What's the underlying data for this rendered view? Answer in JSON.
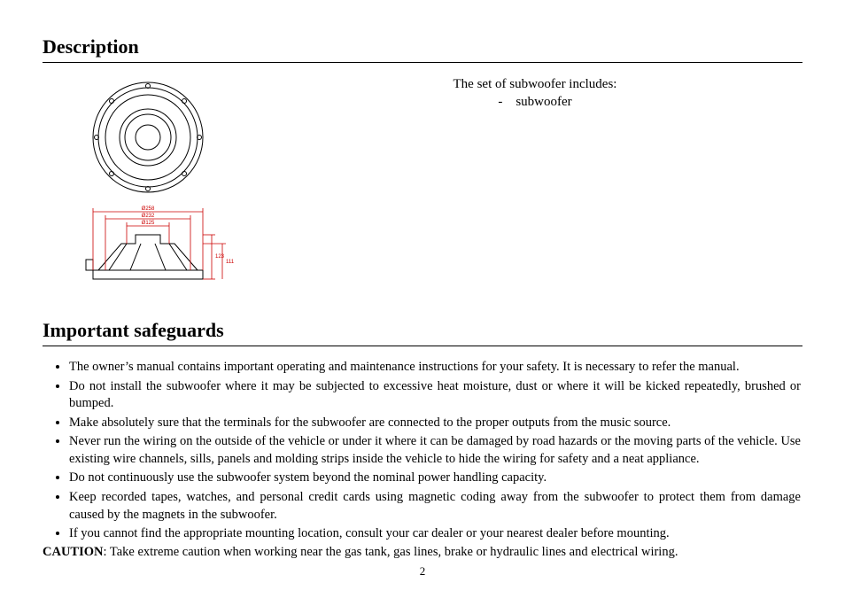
{
  "sections": {
    "description_heading": "Description",
    "safeguards_heading": "Important safeguards"
  },
  "description": {
    "set_intro": "The set of subwoofer includes:",
    "set_item_bullet": "-",
    "set_item_label": "subwoofer"
  },
  "diagram": {
    "dim_258": "Ø258",
    "dim_232": "Ø232",
    "dim_125": "Ø125",
    "dim_h1": "123",
    "dim_h2": "111"
  },
  "safeguards": {
    "items": [
      "The owner’s manual contains important operating and maintenance instructions for your safety. It is necessary to refer the manual.",
      "Do not install the subwoofer where it may be subjected to excessive heat moisture, dust or where it will be kicked repeatedly, brushed or bumped.",
      "Make absolutely sure that the terminals for the subwoofer are connected to the proper outputs from the music source.",
      "Never run the wiring on the outside of the vehicle or under it where it can be damaged by road hazards or the moving parts of the vehicle. Use existing wire channels, sills, panels and molding strips inside the vehicle to hide the wiring for safety and a neat appliance.",
      "Do not continuously use the subwoofer system beyond the nominal power handling capacity.",
      "Keep recorded tapes, watches, and personal credit cards using magnetic coding away from the subwoofer to protect them from damage caused by the magnets in the subwoofer.",
      "If you cannot find the appropriate mounting location, consult your car dealer or your nearest dealer before mounting."
    ],
    "caution_label": "CAUTION",
    "caution_text": ": Take extreme caution when working near the gas tank, gas lines, brake or hydraulic lines and electrical wiring."
  },
  "page_number": "2"
}
